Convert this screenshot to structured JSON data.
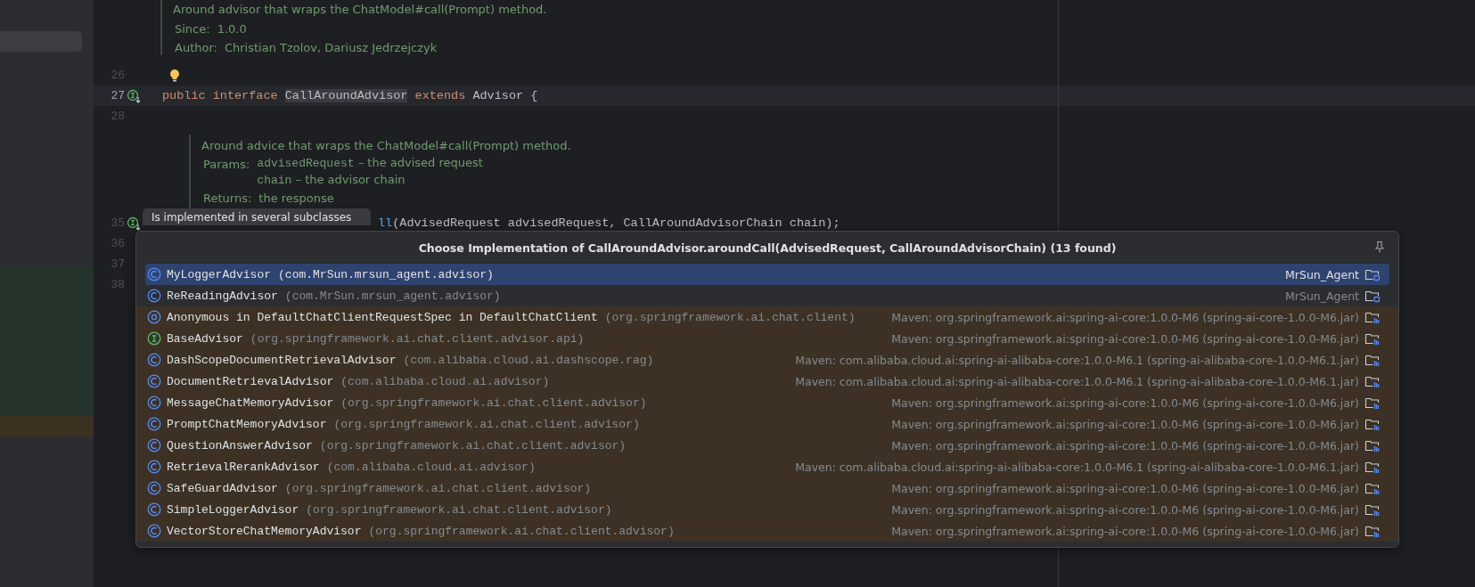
{
  "editor": {
    "top_doc": {
      "description": "Around advisor that wraps the ChatModel#call(Prompt) method.",
      "tags": [
        {
          "label": "Since:",
          "value": "1.0.0"
        },
        {
          "label": "Author:",
          "value": "Christian Tzolov, Dariusz Jedrzejczyk"
        }
      ]
    },
    "lines": [
      {
        "kind": "hint",
        "number": "26",
        "current": false
      },
      {
        "kind": "code",
        "number": "27",
        "current": true,
        "implemented_marker": true,
        "tokens": [
          {
            "text": "public interface ",
            "kind": "keyword"
          },
          {
            "text": "CallAroundAdvisor",
            "kind": "usage"
          },
          {
            "text": " extends ",
            "kind": "keyword"
          },
          {
            "text": "Advisor {",
            "kind": "plain"
          }
        ]
      },
      {
        "kind": "blank",
        "number": "28",
        "current": false
      },
      {
        "kind": "doc",
        "description": "Around advice that wraps the ChatModel#call(Prompt) method.",
        "params_label": "Params:",
        "params": [
          {
            "name": "advisedRequest",
            "text": " – the advised request"
          },
          {
            "name": "chain",
            "text": " – the advisor chain"
          }
        ],
        "returns_label": "Returns:",
        "returns": "the response"
      },
      {
        "kind": "partial_code",
        "number": "35",
        "current": false,
        "implemented_marker": true,
        "tokens": [
          {
            "text": "ll",
            "kind": "method"
          },
          {
            "text": "(AdvisedRequest advisedRequest, CallAroundAdvisorChain chain);",
            "kind": "plain"
          }
        ]
      },
      {
        "kind": "blank",
        "number": "36",
        "current": false
      },
      {
        "kind": "blank",
        "number": "37",
        "current": false
      },
      {
        "kind": "blank",
        "number": "38",
        "current": false
      }
    ]
  },
  "tooltip": {
    "text": "Is implemented in several subclasses"
  },
  "popup": {
    "title": "Choose Implementation of CallAroundAdvisor.aroundCall(AdvisedRequest, CallAroundAdvisorChain) (13 found)",
    "rows": [
      {
        "kind": "class",
        "name": "MyLoggerAdvisor",
        "package": "(com.MrSun.mrsun_agent.advisor)",
        "location": "MrSun_Agent",
        "library": false,
        "selected": true
      },
      {
        "kind": "class",
        "name": "ReReadingAdvisor",
        "package": "(com.MrSun.mrsun_agent.advisor)",
        "location": "MrSun_Agent",
        "library": false,
        "selected": false
      },
      {
        "kind": "anonymous",
        "name": "Anonymous in DefaultChatClientRequestSpec in DefaultChatClient",
        "package": "(org.springframework.ai.chat.client)",
        "location": "Maven: org.springframework.ai:spring-ai-core:1.0.0-M6 (spring-ai-core-1.0.0-M6.jar)",
        "library": true,
        "selected": false
      },
      {
        "kind": "interface",
        "name": "BaseAdvisor",
        "package": "(org.springframework.ai.chat.client.advisor.api)",
        "location": "Maven: org.springframework.ai:spring-ai-core:1.0.0-M6 (spring-ai-core-1.0.0-M6.jar)",
        "library": true,
        "selected": false
      },
      {
        "kind": "class",
        "name": "DashScopeDocumentRetrievalAdvisor",
        "package": "(com.alibaba.cloud.ai.dashscope.rag)",
        "location": "Maven: com.alibaba.cloud.ai:spring-ai-alibaba-core:1.0.0-M6.1 (spring-ai-alibaba-core-1.0.0-M6.1.jar)",
        "library": true,
        "selected": false
      },
      {
        "kind": "class",
        "name": "DocumentRetrievalAdvisor",
        "package": "(com.alibaba.cloud.ai.advisor)",
        "location": "Maven: com.alibaba.cloud.ai:spring-ai-alibaba-core:1.0.0-M6.1 (spring-ai-alibaba-core-1.0.0-M6.1.jar)",
        "library": true,
        "selected": false
      },
      {
        "kind": "class",
        "name": "MessageChatMemoryAdvisor",
        "package": "(org.springframework.ai.chat.client.advisor)",
        "location": "Maven: org.springframework.ai:spring-ai-core:1.0.0-M6 (spring-ai-core-1.0.0-M6.jar)",
        "library": true,
        "selected": false
      },
      {
        "kind": "class",
        "name": "PromptChatMemoryAdvisor",
        "package": "(org.springframework.ai.chat.client.advisor)",
        "location": "Maven: org.springframework.ai:spring-ai-core:1.0.0-M6 (spring-ai-core-1.0.0-M6.jar)",
        "library": true,
        "selected": false
      },
      {
        "kind": "class",
        "name": "QuestionAnswerAdvisor",
        "package": "(org.springframework.ai.chat.client.advisor)",
        "location": "Maven: org.springframework.ai:spring-ai-core:1.0.0-M6 (spring-ai-core-1.0.0-M6.jar)",
        "library": true,
        "selected": false
      },
      {
        "kind": "class",
        "name": "RetrievalRerankAdvisor",
        "package": "(com.alibaba.cloud.ai.advisor)",
        "location": "Maven: com.alibaba.cloud.ai:spring-ai-alibaba-core:1.0.0-M6.1 (spring-ai-alibaba-core-1.0.0-M6.1.jar)",
        "library": true,
        "selected": false
      },
      {
        "kind": "class",
        "name": "SafeGuardAdvisor",
        "package": "(org.springframework.ai.chat.client.advisor)",
        "location": "Maven: org.springframework.ai:spring-ai-core:1.0.0-M6 (spring-ai-core-1.0.0-M6.jar)",
        "library": true,
        "selected": false
      },
      {
        "kind": "class",
        "name": "SimpleLoggerAdvisor",
        "package": "(org.springframework.ai.chat.client.advisor)",
        "location": "Maven: org.springframework.ai:spring-ai-core:1.0.0-M6 (spring-ai-core-1.0.0-M6.jar)",
        "library": true,
        "selected": false
      },
      {
        "kind": "class",
        "name": "VectorStoreChatMemoryAdvisor",
        "package": "(org.springframework.ai.chat.client.advisor)",
        "location": "Maven: org.springframework.ai:spring-ai-core:1.0.0-M6 (spring-ai-core-1.0.0-M6.jar)",
        "library": true,
        "selected": false
      }
    ]
  }
}
